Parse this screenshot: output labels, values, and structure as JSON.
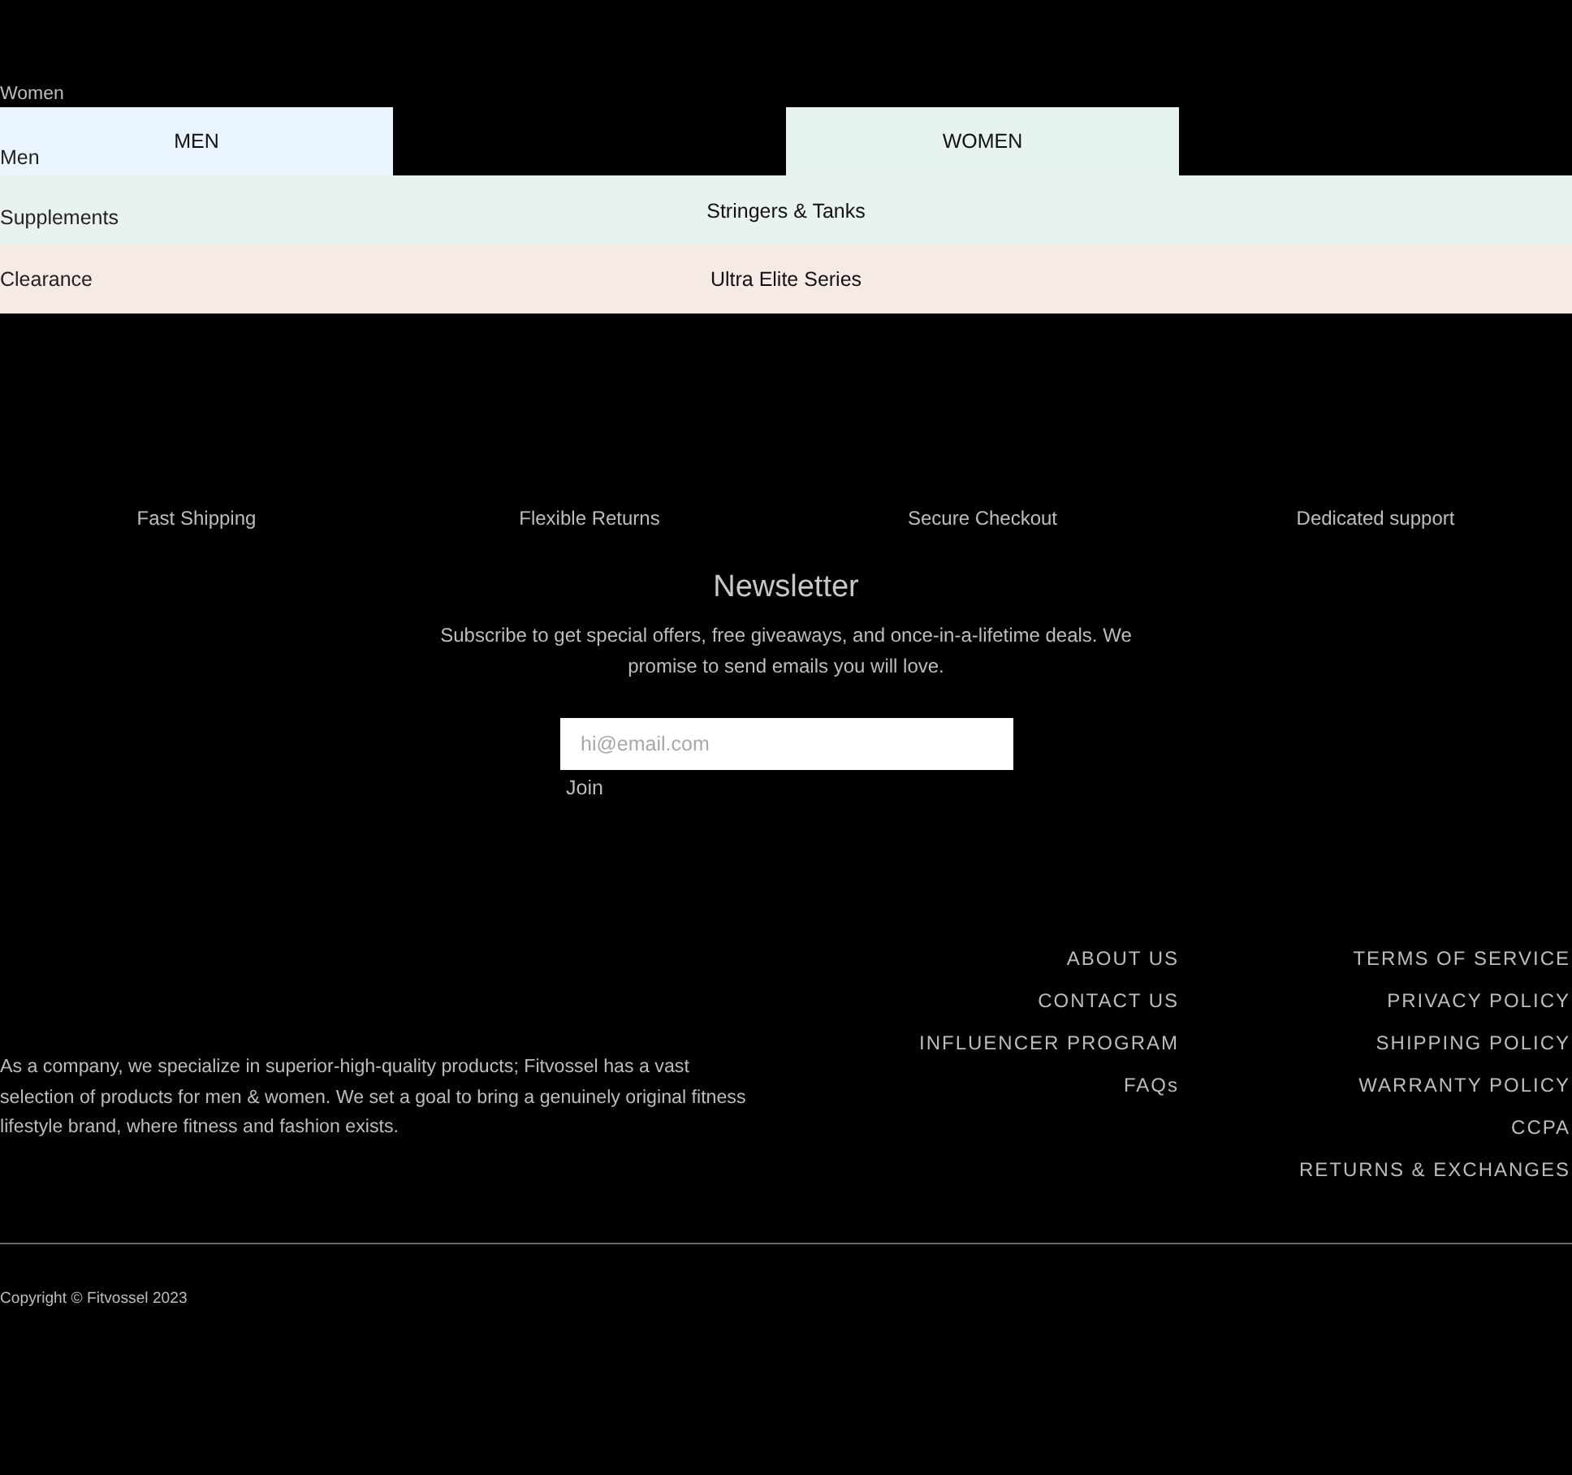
{
  "category_links": [
    "Women",
    "Men",
    "Supplements",
    "Clearance"
  ],
  "collection_tiles": [
    {
      "label": "MEN",
      "kind": "small",
      "color": "#eaf4fd"
    },
    {
      "label": "WOMEN",
      "kind": "small",
      "color": "#e7f3ef"
    },
    {
      "label": "Stringers & Tanks",
      "kind": "wide",
      "color": "#e8f3f0"
    },
    {
      "label": "Ultra Elite Series",
      "kind": "wide",
      "color": "#f5ebe4"
    }
  ],
  "features": [
    "Fast Shipping",
    "Flexible Returns",
    "Secure Checkout",
    "Dedicated support"
  ],
  "newsletter": {
    "title": "Newsletter",
    "text": "Subscribe to get special offers, free giveaways, and once-in-a-lifetime deals. We promise to send emails you will love.",
    "email": {
      "placeholder": "hi@email.com"
    },
    "button": "Join"
  },
  "footer": {
    "about": "As a company, we specialize in superior-high-quality products; Fitvossel has a vast selection of products for men & women. We set a goal to bring a genuinely original fitness lifestyle brand, where fitness and fashion exists.",
    "links_1": [
      "ABOUT US",
      "CONTACT US",
      "INFLUENCER PROGRAM",
      "FAQs"
    ],
    "links_2": [
      "TERMS OF SERVICE",
      "PRIVACY POLICY",
      "SHIPPING POLICY",
      "WARRANTY POLICY",
      "CCPA",
      "RETURNS & EXCHANGES"
    ],
    "copyright": "Copyright © Fitvossel 2023"
  }
}
